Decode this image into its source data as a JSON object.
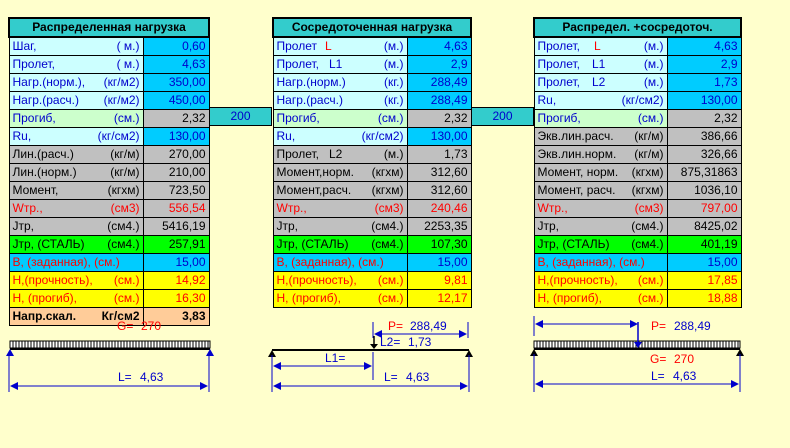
{
  "table1": {
    "title": "Распределенная нагрузка",
    "rows": [
      {
        "label": "Шаг,",
        "unit": "( м.)",
        "value": "0,60"
      },
      {
        "label": "Пролет,",
        "unit": "( м.)",
        "value": "4,63"
      },
      {
        "label": "Нагр.(норм.),",
        "unit": "(кг/м2)",
        "value": "350,00"
      },
      {
        "label": "Нагр.(расч.)",
        "unit": "(кг/м2)",
        "value": "450,00"
      },
      {
        "label": "Прогиб,",
        "unit": "(см.)",
        "value": "2,32"
      },
      {
        "label": "Ru,",
        "unit": "(кг/см2)",
        "value": "130,00"
      },
      {
        "label": "Лин.(расч.)",
        "unit": "(кг/м)",
        "value": "270,00"
      },
      {
        "label": "Лин.(норм.)",
        "unit": "(кг/м)",
        "value": "210,00"
      },
      {
        "label": "Момент,",
        "unit": "(кгхм)",
        "value": "723,50"
      },
      {
        "label": "Wтр.,",
        "unit": "(см3)",
        "value": "556,54"
      },
      {
        "label": "Jтр,",
        "unit": "(см4.)",
        "value": "5416,19"
      },
      {
        "label": "Jтр, (СТАЛЬ)",
        "unit": "(см4.)",
        "value": "257,91"
      },
      {
        "label": "B, (заданная), (см.)",
        "unit": "",
        "value": "15,00"
      },
      {
        "label": "H,(прочность),",
        "unit": "(см.)",
        "value": "14,92"
      },
      {
        "label": "H, (прогиб),",
        "unit": "(см.)",
        "value": "16,30"
      },
      {
        "label": "Напр.скал.",
        "unit": "Кг/см2",
        "value": "3,83"
      }
    ]
  },
  "table2": {
    "title": "Сосредоточенная нагрузка",
    "rows": [
      {
        "label": "Пролет",
        "sym": "L",
        "unit": "(м.)",
        "value": "4,63"
      },
      {
        "label": "Пролет,",
        "sym": "L1",
        "unit": "(м.)",
        "value": "2,9"
      },
      {
        "label": "Нагр.(норм.)",
        "sym": "",
        "unit": "(кг.)",
        "value": "288,49"
      },
      {
        "label": "Нагр.(расч.)",
        "sym": "",
        "unit": "(кг.)",
        "value": "288,49"
      },
      {
        "label": "Прогиб,",
        "sym": "",
        "unit": "(см.)",
        "value": "2,32"
      },
      {
        "label": "Ru,",
        "sym": "",
        "unit": "(кг/см2)",
        "value": "130,00"
      },
      {
        "label": "Пролет,",
        "sym": "L2",
        "unit": "(м.)",
        "value": "1,73"
      },
      {
        "label": "Момент,норм.",
        "sym": "",
        "unit": "(кгхм)",
        "value": "312,60"
      },
      {
        "label": "Момент,расч.",
        "sym": "",
        "unit": "(кгхм)",
        "value": "312,60"
      },
      {
        "label": "Wтр.,",
        "sym": "",
        "unit": "(см3)",
        "value": "240,46"
      },
      {
        "label": "Jтр,",
        "sym": "",
        "unit": "(см4.)",
        "value": "2253,35"
      },
      {
        "label": "Jтр, (СТАЛЬ)",
        "sym": "",
        "unit": "(см4.)",
        "value": "107,30"
      },
      {
        "label": "B, (заданная), (см.)",
        "sym": "",
        "unit": "",
        "value": "15,00"
      },
      {
        "label": "H,(прочность),",
        "sym": "",
        "unit": "(см.)",
        "value": "9,81"
      },
      {
        "label": "H, (прогиб),",
        "sym": "",
        "unit": "(см.)",
        "value": "12,17"
      }
    ]
  },
  "table3": {
    "title": "Распредел. +сосредоточ.",
    "rows": [
      {
        "label": "Пролет,",
        "sym": "L",
        "unit": "(м.)",
        "value": "4,63"
      },
      {
        "label": "Пролет,",
        "sym": "L1",
        "unit": "(м.)",
        "value": "2,9"
      },
      {
        "label": "Пролет,",
        "sym": "L2",
        "unit": "(м.)",
        "value": "1,73"
      },
      {
        "label": "Ru,",
        "sym": "",
        "unit": "(кг/см2)",
        "value": "130,00"
      },
      {
        "label": "Прогиб,",
        "sym": "",
        "unit": "(см.)",
        "value": "2,32"
      },
      {
        "label": "Экв.лин.расч.",
        "sym": "",
        "unit": "(кг/м)",
        "value": "386,66"
      },
      {
        "label": "Экв.лин.норм.",
        "sym": "",
        "unit": "(кг/м)",
        "value": "326,66"
      },
      {
        "label": "Момент, норм.",
        "sym": "",
        "unit": "(кгхм)",
        "value": "875,31863"
      },
      {
        "label": "Момент, расч.",
        "sym": "",
        "unit": "(кгхм)",
        "value": "1036,10"
      },
      {
        "label": "Wтр.,",
        "sym": "",
        "unit": "(см3)",
        "value": "797,00"
      },
      {
        "label": "Jтр,",
        "sym": "",
        "unit": "(см4.)",
        "value": "8425,02"
      },
      {
        "label": "Jтр, (СТАЛЬ)",
        "sym": "",
        "unit": "(см4.)",
        "value": "401,19"
      },
      {
        "label": "B, (заданная), (см.)",
        "sym": "",
        "unit": "",
        "value": "15,00"
      },
      {
        "label": "H,(прочность),",
        "sym": "",
        "unit": "(см.)",
        "value": "17,85"
      },
      {
        "label": "H, (прогиб),",
        "sym": "",
        "unit": "(см.)",
        "value": "18,88"
      }
    ]
  },
  "links": {
    "link1": "200",
    "link2": "200"
  },
  "diagram1": {
    "g_label": "G=",
    "g_value": "270",
    "l_label": "L=",
    "l_value": "4,63"
  },
  "diagram2": {
    "p_label": "P=",
    "p_value": "288,49",
    "l2_label": "L2=",
    "l2_value": "1,73",
    "l1_label": "L1=",
    "l_label": "L=",
    "l_value": "4,63"
  },
  "diagram3": {
    "p_label": "P=",
    "p_value": "288,49",
    "g_label": "G=",
    "g_value": "270",
    "l_label": "L=",
    "l_value": "4,63"
  },
  "colors": {
    "background": "#ffffcc",
    "header": "#33cccc",
    "input": "#00ccff",
    "gray": "#c0c0c0",
    "steel": "#00ff00",
    "height": "#ffff00",
    "label_blue": "#0000cc",
    "label_red": "#ff0000"
  }
}
